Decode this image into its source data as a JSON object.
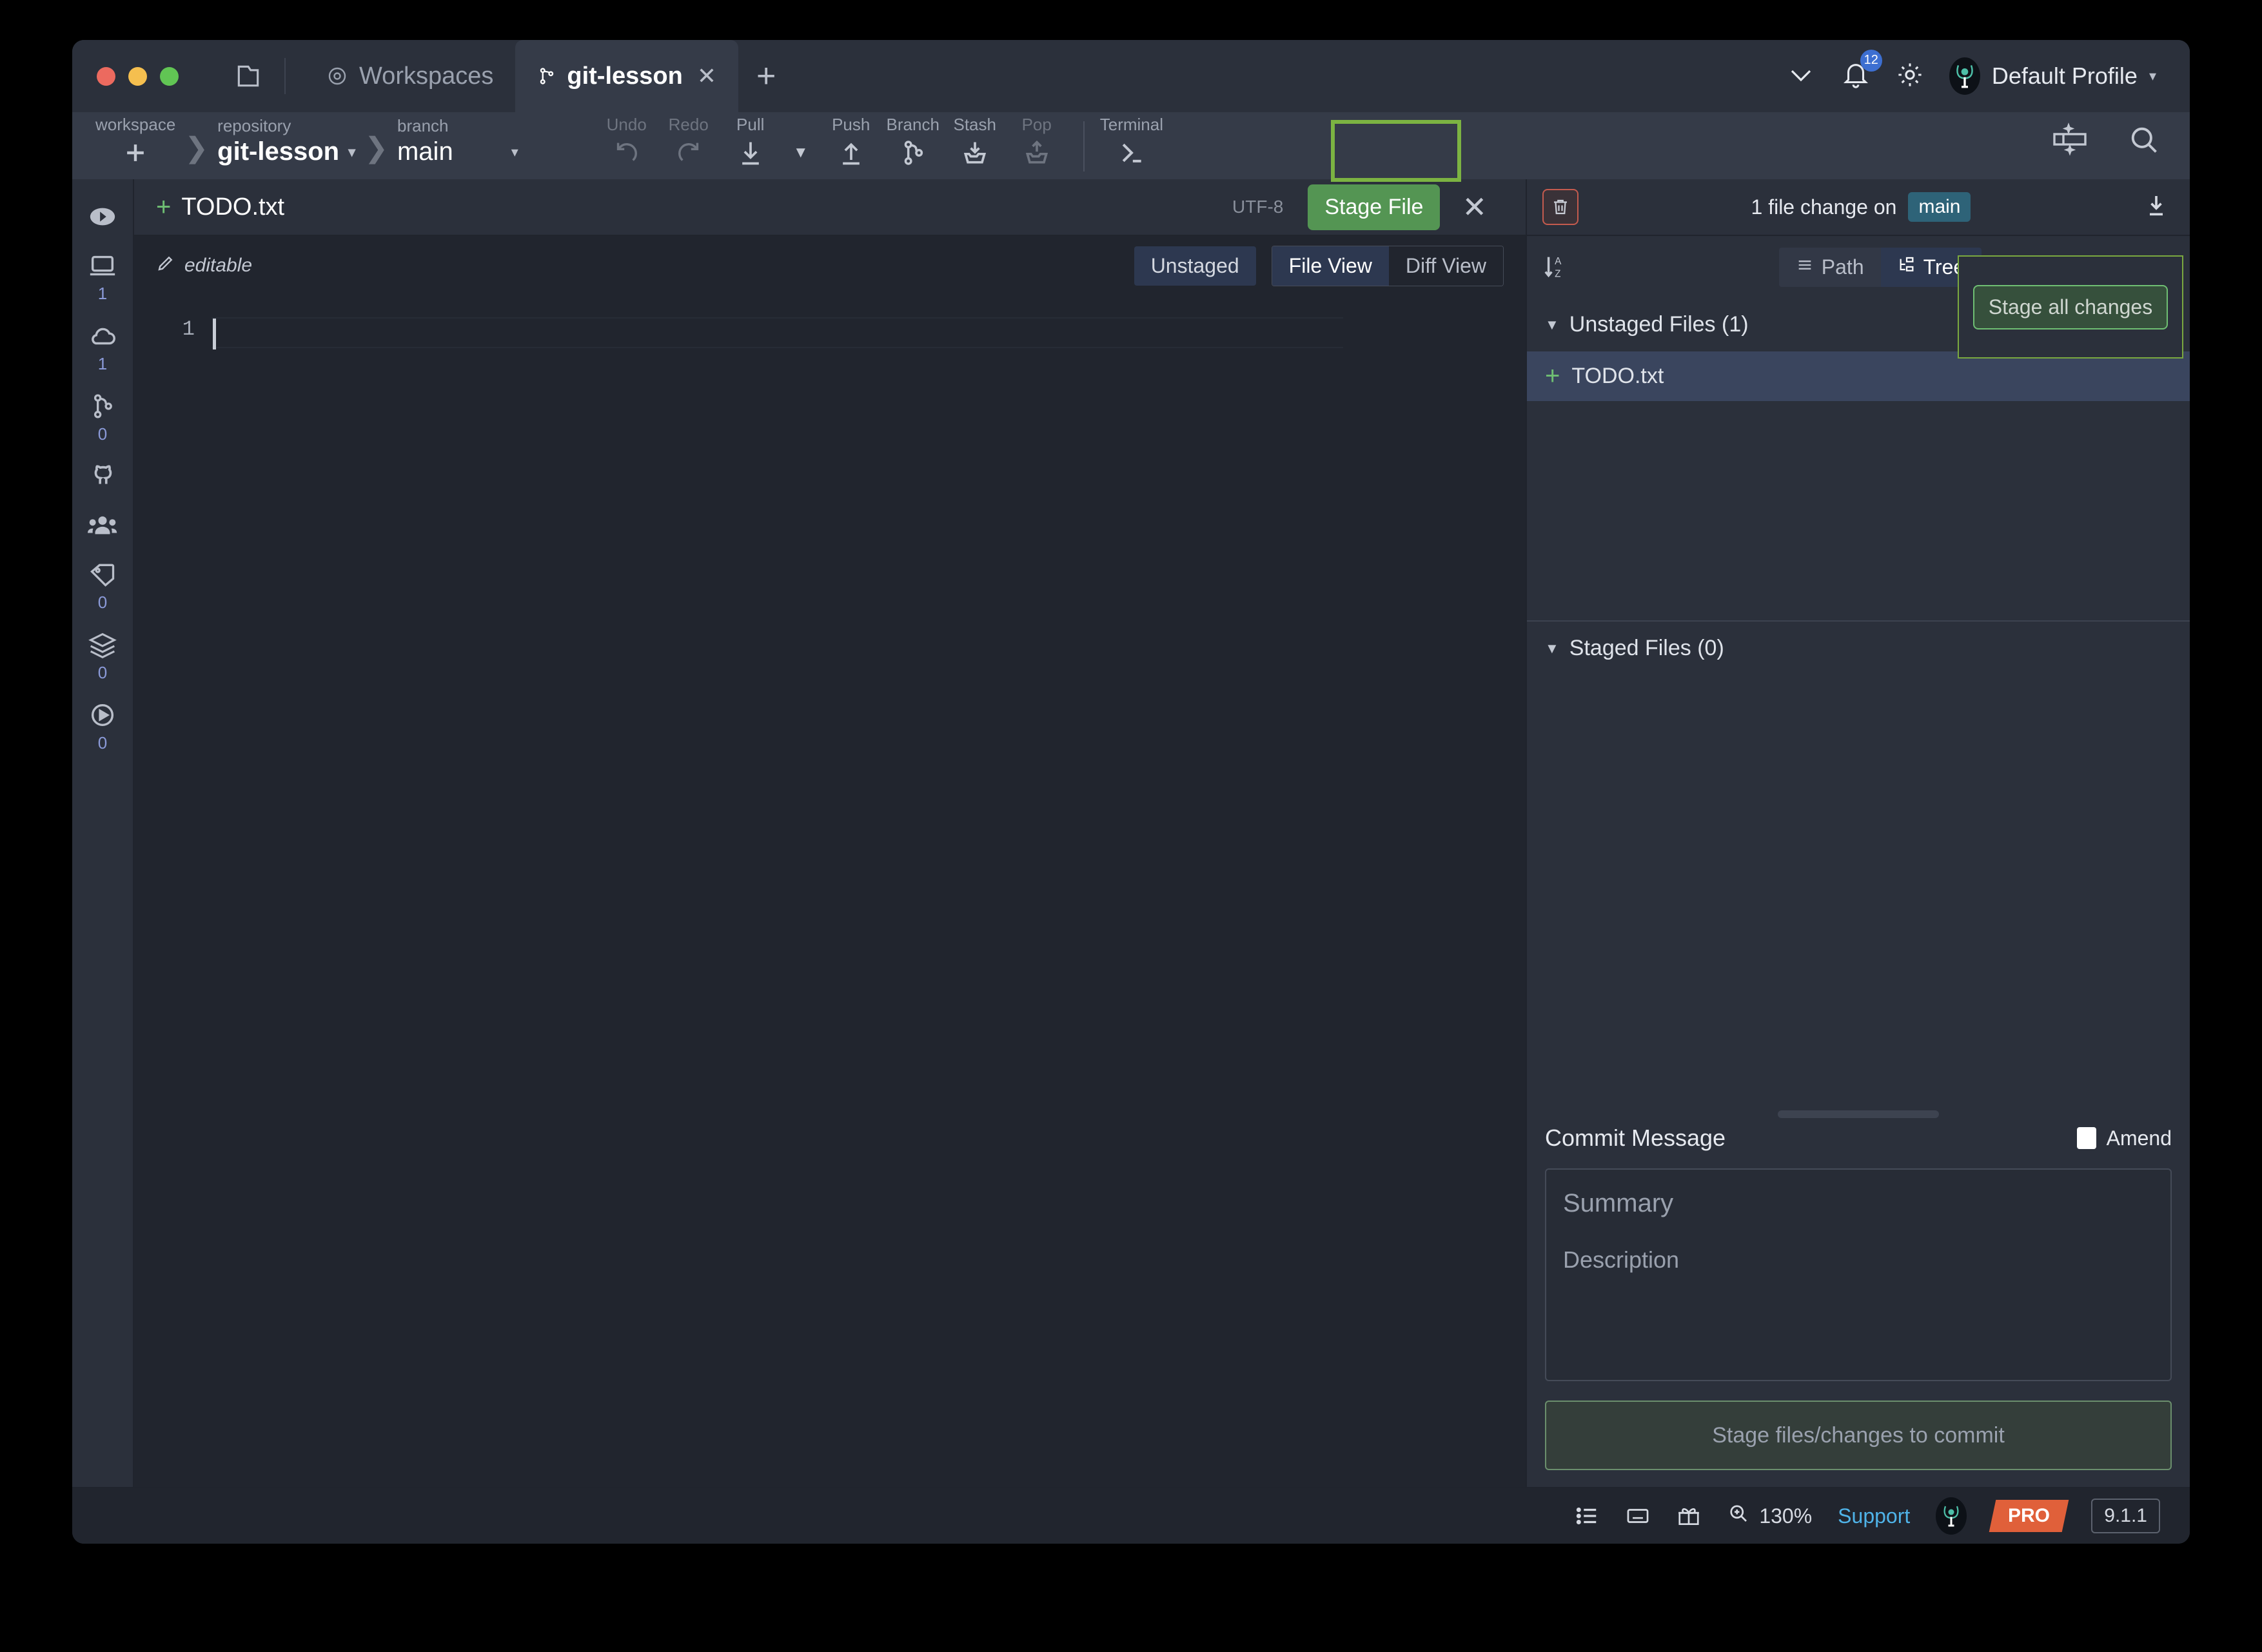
{
  "window": {
    "traffic_lights": [
      "close",
      "minimize",
      "maximize"
    ]
  },
  "titlebar": {
    "folder_icon": "folder-icon",
    "tabs": [
      {
        "label": "Workspaces",
        "icon": "workspaces-icon",
        "active": false,
        "closable": false
      },
      {
        "label": "git-lesson",
        "icon": "branch-icon",
        "active": true,
        "closable": true
      }
    ],
    "new_tab_label": "+",
    "chevron_icon": "chevron-down-icon",
    "notification_icon": "bell-icon",
    "notification_count": "12",
    "settings_icon": "gear-icon",
    "profile_label": "Default Profile",
    "profile_caret": "▾"
  },
  "toolbar": {
    "workspace_label": "workspace",
    "workspace_add": "+",
    "repository_label": "repository",
    "repository_value": "git-lesson",
    "branch_label": "branch",
    "branch_value": "main",
    "actions": [
      {
        "label": "Undo",
        "icon": "undo-icon",
        "enabled": false
      },
      {
        "label": "Redo",
        "icon": "redo-icon",
        "enabled": false
      },
      {
        "label": "Pull",
        "icon": "pull-icon",
        "enabled": true
      },
      {
        "label": "Push",
        "icon": "push-icon",
        "enabled": true
      },
      {
        "label": "Branch",
        "icon": "branch-icon",
        "enabled": true
      },
      {
        "label": "Stash",
        "icon": "stash-icon",
        "enabled": true
      },
      {
        "label": "Pop",
        "icon": "pop-icon",
        "enabled": false
      },
      {
        "label": "Terminal",
        "icon": "terminal-icon",
        "enabled": true
      }
    ],
    "layout_icon": "layout-toggle-icon",
    "search_icon": "search-icon"
  },
  "rail": {
    "items": [
      {
        "name": "commit-graph",
        "icon": "arrow-circle-icon",
        "count": ""
      },
      {
        "name": "local-repos",
        "icon": "laptop-icon",
        "count": "1"
      },
      {
        "name": "remotes",
        "icon": "cloud-icon",
        "count": "1"
      },
      {
        "name": "branches",
        "icon": "branch-icon",
        "count": "0"
      },
      {
        "name": "pull-requests",
        "icon": "github-icon",
        "count": ""
      },
      {
        "name": "team",
        "icon": "people-icon",
        "count": ""
      },
      {
        "name": "tags",
        "icon": "tag-icon",
        "count": "0"
      },
      {
        "name": "stashes",
        "icon": "layers-icon",
        "count": "0"
      },
      {
        "name": "actions",
        "icon": "play-icon",
        "count": "0"
      }
    ]
  },
  "editor": {
    "file_status_icon": "+",
    "file_name": "TODO.txt",
    "encoding": "UTF-8",
    "stage_file_label": "Stage File",
    "close_icon": "close-icon",
    "editable_label": "editable",
    "editable_icon": "pencil-icon",
    "status_pill": "Unstaged",
    "views": [
      {
        "label": "File View",
        "active": true
      },
      {
        "label": "Diff View",
        "active": false
      }
    ],
    "lines": [
      {
        "number": "1",
        "text": ""
      }
    ]
  },
  "right_panel": {
    "discard_icon": "trash-icon",
    "summary_text": "1 file change on",
    "branch_chip": "main",
    "download_icon": "download-icon",
    "sort_icon": "sort-az-icon",
    "view_tabs": [
      {
        "label": "Path",
        "icon": "list-icon",
        "active": false
      },
      {
        "label": "Tree",
        "icon": "tree-icon",
        "active": true
      }
    ],
    "stage_all_tooltip": "Stage all changes",
    "unstaged_header": "Unstaged Files (1)",
    "unstaged_files": [
      {
        "status": "+",
        "name": "TODO.txt",
        "selected": true
      }
    ],
    "staged_header": "Staged Files (0)",
    "staged_files": [],
    "commit_message_label": "Commit Message",
    "amend_label": "Amend",
    "amend_checked": false,
    "summary_placeholder": "Summary",
    "description_placeholder": "Description",
    "commit_button_label": "Stage files/changes to commit"
  },
  "statusbar": {
    "list_icon": "list-view-icon",
    "keyboard_icon": "keyboard-icon",
    "gift_icon": "gift-icon",
    "zoom_icon": "zoom-icon",
    "zoom_level": "130%",
    "support_label": "Support",
    "avatar_icon": "kraken-avatar-icon",
    "pro_badge": "PRO",
    "version": "9.1.1"
  },
  "colors": {
    "accent_green": "#549553",
    "highlight_green": "#7cb342",
    "branch_chip_blue": "#2e6378",
    "danger_red": "#c45b4e",
    "pro_orange": "#e0603a",
    "link_blue": "#4fb3e8",
    "selection_blue": "#3a455e"
  }
}
